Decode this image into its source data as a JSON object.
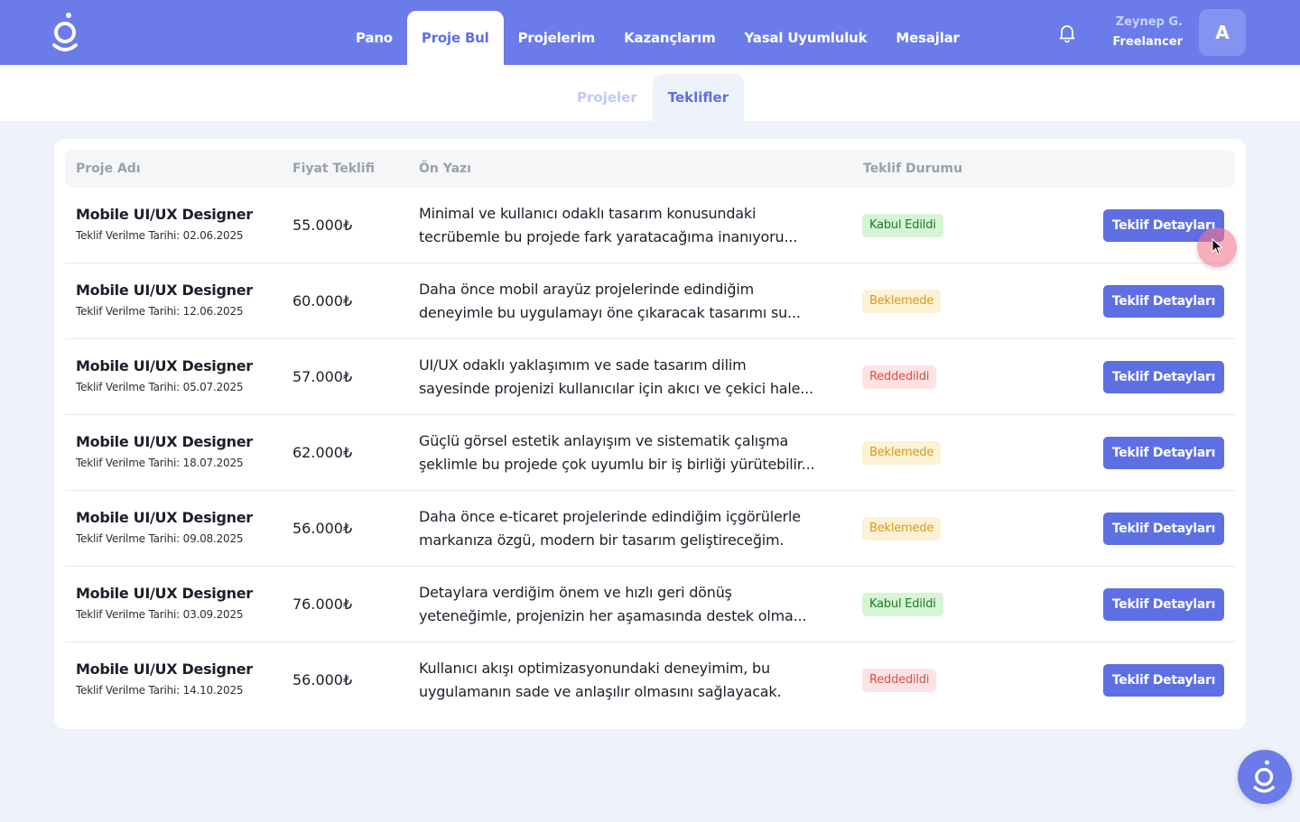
{
  "header": {
    "logo_icon": "brand-logo-icon",
    "nav": [
      {
        "label": "Pano",
        "active": false
      },
      {
        "label": "Proje Bul",
        "active": true
      },
      {
        "label": "Projelerim",
        "active": false
      },
      {
        "label": "Kazançlarım",
        "active": false
      },
      {
        "label": "Yasal Uyumluluk",
        "active": false
      },
      {
        "label": "Mesajlar",
        "active": false
      }
    ],
    "notification_icon": "bell-icon",
    "user": {
      "name": "Zeynep G.",
      "role": "Freelancer",
      "avatar_initial": "A"
    }
  },
  "subtabs": [
    {
      "label": "Projeler",
      "active": false
    },
    {
      "label": "Teklifler",
      "active": true
    }
  ],
  "table": {
    "columns": [
      "Proje Adı",
      "Fiyat Teklifi",
      "Ön Yazı",
      "Teklif Durumu"
    ],
    "date_prefix": "Teklif Verilme Tarihi: ",
    "rows": [
      {
        "name": "Mobile UI/UX Designer",
        "date": "Teklif Verilme Tarihi: 02.06.2025",
        "price": "55.000₺",
        "desc1": "Minimal ve kullanıcı odaklı tasarım konusundaki",
        "desc2": "tecrübemle bu projede fark yaratacağıma inanıyoru...",
        "status": "Kabul Edildi",
        "status_type": "accepted",
        "action": "Teklif Detayları"
      },
      {
        "name": "Mobile UI/UX Designer",
        "date": "Teklif Verilme Tarihi: 12.06.2025",
        "price": "60.000₺",
        "desc1": "Daha önce mobil arayüz projelerinde edindiğim",
        "desc2": "deneyimle bu uygulamayı öne çıkaracak tasarımı su...",
        "status": "Beklemede",
        "status_type": "pending",
        "action": "Teklif Detayları"
      },
      {
        "name": "Mobile UI/UX Designer",
        "date": "Teklif Verilme Tarihi: 05.07.2025",
        "price": "57.000₺",
        "desc1": "UI/UX odaklı yaklaşımım ve sade tasarım dilim",
        "desc2": "sayesinde projenizi kullanıcılar için akıcı ve çekici hale...",
        "status": "Reddedildi",
        "status_type": "rejected",
        "action": "Teklif Detayları"
      },
      {
        "name": "Mobile UI/UX Designer",
        "date": "Teklif Verilme Tarihi: 18.07.2025",
        "price": "62.000₺",
        "desc1": "Güçlü görsel estetik anlayışım ve sistematik çalışma",
        "desc2": "şeklimle bu projede çok uyumlu bir iş birliği yürütebilir...",
        "status": "Beklemede",
        "status_type": "pending",
        "action": "Teklif Detayları"
      },
      {
        "name": "Mobile UI/UX Designer",
        "date": "Teklif Verilme Tarihi: 09.08.2025",
        "price": "56.000₺",
        "desc1": "Daha önce e-ticaret projelerinde edindiğim içgörülerle",
        "desc2": "markanıza özgü, modern bir tasarım geliştireceğim.",
        "status": "Beklemede",
        "status_type": "pending",
        "action": "Teklif Detayları"
      },
      {
        "name": "Mobile UI/UX Designer",
        "date": "Teklif Verilme Tarihi: 03.09.2025",
        "price": "76.000₺",
        "desc1": "Detaylara verdiğim önem ve hızlı geri dönüş",
        "desc2": "yeteneğimle, projenizin her aşamasında destek olma...",
        "status": "Kabul Edildi",
        "status_type": "accepted",
        "action": "Teklif Detayları"
      },
      {
        "name": "Mobile UI/UX Designer",
        "date": "Teklif Verilme Tarihi: 14.10.2025",
        "price": "56.000₺",
        "desc1": "Kullanıcı akışı optimizasyonundaki deneyimim, bu",
        "desc2": "uygulamanın sade ve anlaşılır olmasını sağlayacak.",
        "status": "Reddedildi",
        "status_type": "rejected",
        "action": "Teklif Detayları"
      }
    ]
  },
  "fab_icon": "brand-logo-icon",
  "colors": {
    "primary": "#6b7bea",
    "accent": "#5e6fe4",
    "background": "#eef2fb",
    "accepted": "#1e7a27",
    "pending": "#d79a1d",
    "rejected": "#e04b4b"
  }
}
